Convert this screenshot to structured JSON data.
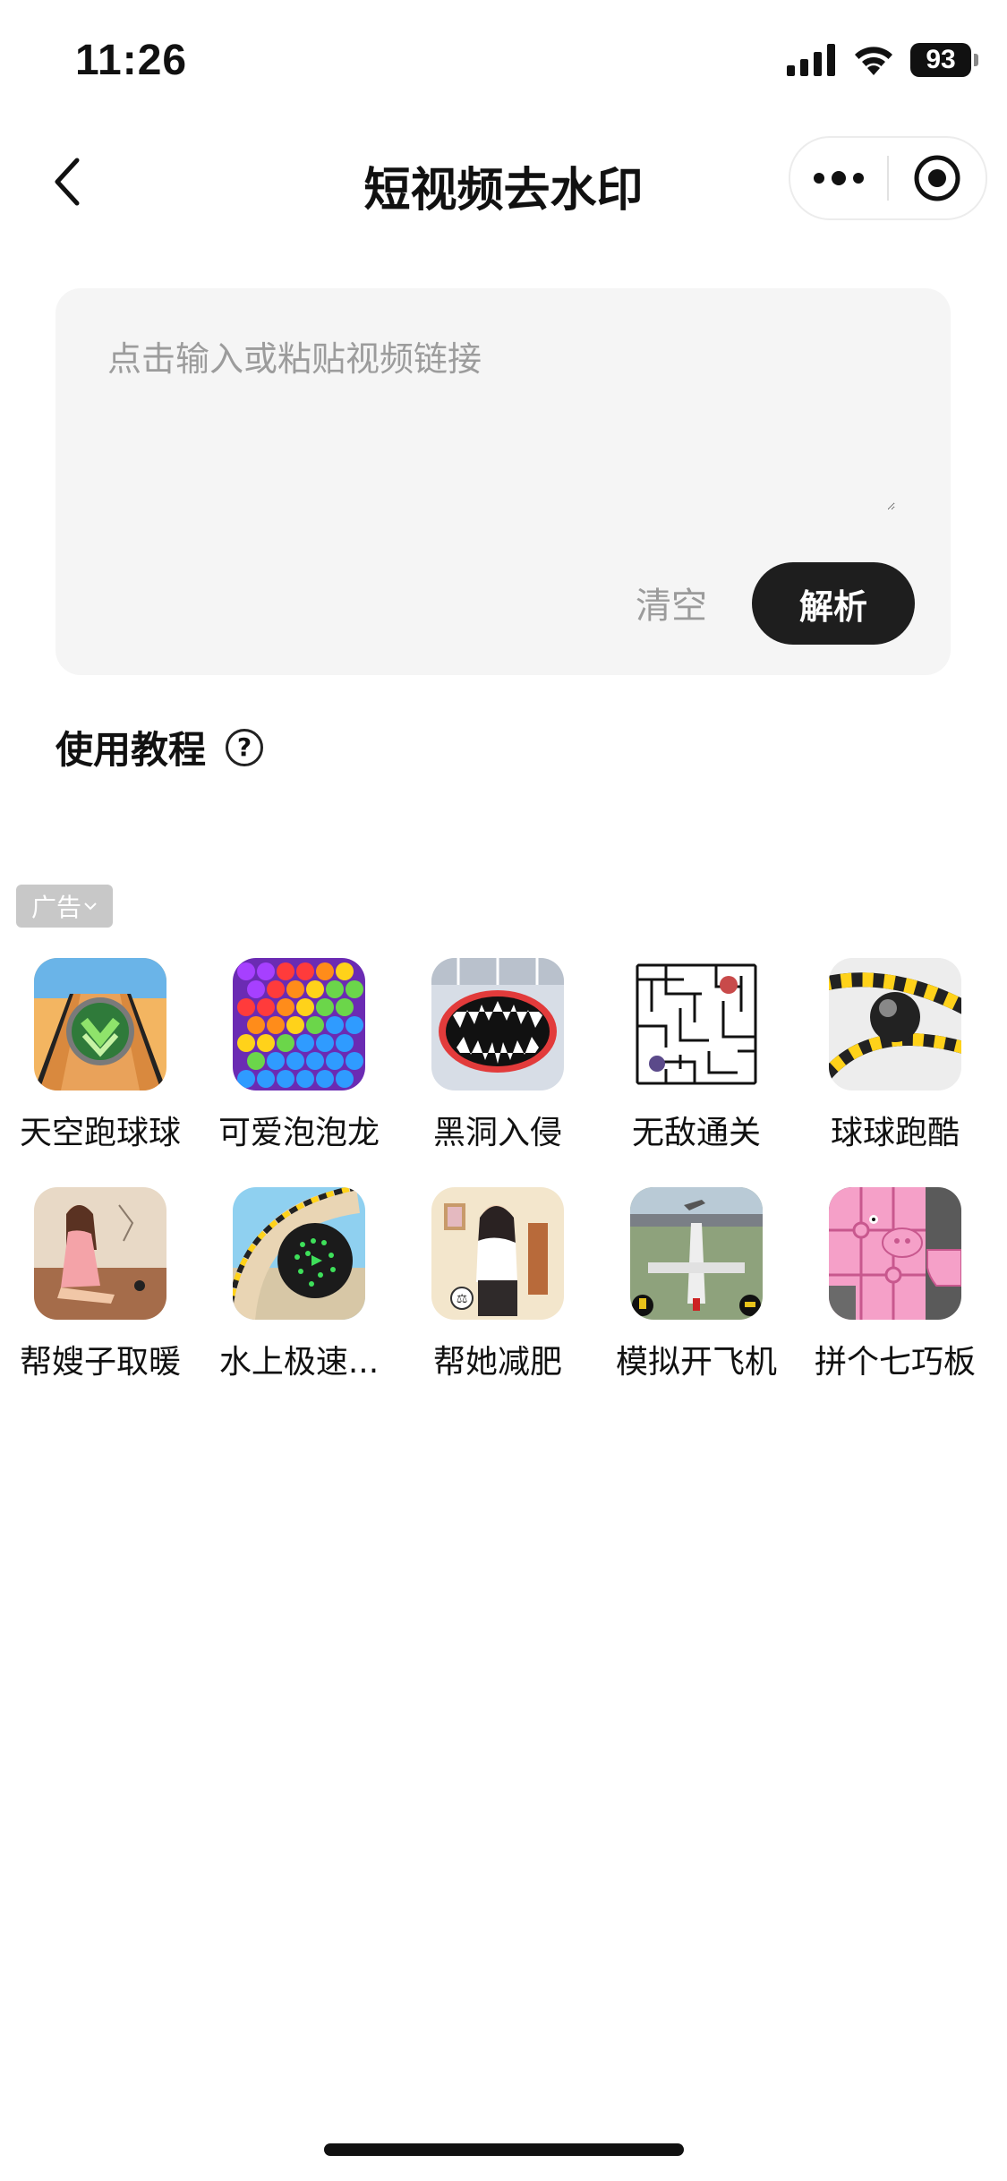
{
  "status_bar": {
    "time": "11:26",
    "battery": "93"
  },
  "nav": {
    "title": "短视频去水印"
  },
  "input": {
    "placeholder": "点击输入或粘贴视频链接",
    "clear_label": "清空",
    "parse_label": "解析"
  },
  "tutorial": {
    "label": "使用教程"
  },
  "ad": {
    "badge": "广告"
  },
  "games": [
    {
      "name": "天空跑球球",
      "icon": "rolling-ball-track-icon"
    },
    {
      "name": "可爱泡泡龙",
      "icon": "bubble-shooter-icon"
    },
    {
      "name": "黑洞入侵",
      "icon": "black-hole-mouth-icon"
    },
    {
      "name": "无敌通关",
      "icon": "maze-icon"
    },
    {
      "name": "球球跑酷",
      "icon": "ball-parkour-icon"
    },
    {
      "name": "帮嫂子取暖",
      "icon": "woman-sitting-icon"
    },
    {
      "name": "水上极速...",
      "icon": "green-ball-race-icon"
    },
    {
      "name": "帮她减肥",
      "icon": "woman-fitness-icon"
    },
    {
      "name": "模拟开飞机",
      "icon": "airplane-simulator-icon"
    },
    {
      "name": "拼个七巧板",
      "icon": "pink-pig-puzzle-icon"
    }
  ]
}
